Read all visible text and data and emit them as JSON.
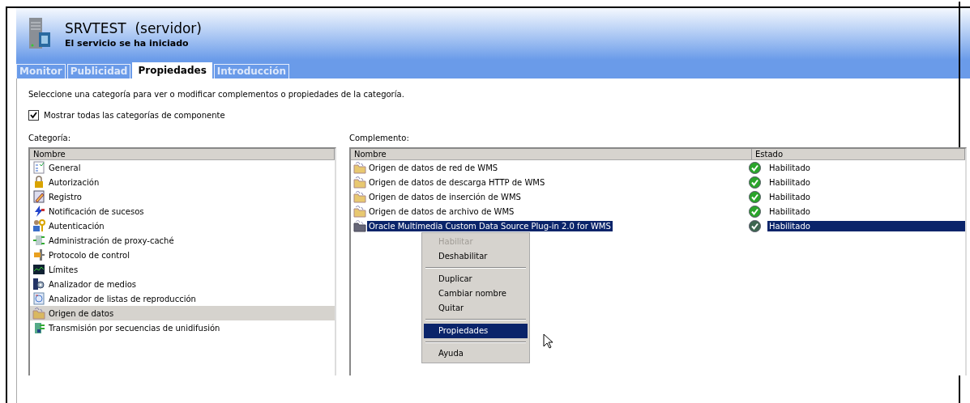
{
  "header": {
    "title": "SRVTEST  (servidor)",
    "subtitle": "El servicio se ha iniciado"
  },
  "tabs": [
    {
      "label": "Monitor",
      "selected": false
    },
    {
      "label": "Publicidad",
      "selected": false
    },
    {
      "label": "Propiedades",
      "selected": true
    },
    {
      "label": "Introducción",
      "selected": false
    }
  ],
  "instructions": "Seleccione una categoría para ver o modificar complementos o propiedades de la categoría.",
  "show_all_checkbox": {
    "label": "Mostrar todas las categorías de componente",
    "checked": true
  },
  "category_list": {
    "label": "Categoría:",
    "columns": [
      "Nombre"
    ],
    "items": [
      {
        "name": "General",
        "selected": false
      },
      {
        "name": "Autorización",
        "selected": false
      },
      {
        "name": "Registro",
        "selected": false
      },
      {
        "name": "Notificación de sucesos",
        "selected": false
      },
      {
        "name": "Autenticación",
        "selected": false
      },
      {
        "name": "Administración de proxy-caché",
        "selected": false
      },
      {
        "name": "Protocolo de control",
        "selected": false
      },
      {
        "name": "Límites",
        "selected": false
      },
      {
        "name": "Analizador de medios",
        "selected": false
      },
      {
        "name": "Analizador de listas de reproducción",
        "selected": false
      },
      {
        "name": "Origen de datos",
        "selected": true
      },
      {
        "name": "Transmisión por secuencias de unidifusión",
        "selected": false
      }
    ]
  },
  "plugin_list": {
    "label": "Complemento:",
    "columns": [
      "Nombre",
      "Estado"
    ],
    "rows": [
      {
        "name": "Origen de datos de red de WMS",
        "status": "Habilitado",
        "selected": false
      },
      {
        "name": "Origen de datos de descarga HTTP de WMS",
        "status": "Habilitado",
        "selected": false
      },
      {
        "name": "Origen de datos de inserción de WMS",
        "status": "Habilitado",
        "selected": false
      },
      {
        "name": "Origen de datos de archivo de WMS",
        "status": "Habilitado",
        "selected": false
      },
      {
        "name": "Oracle Multimedia Custom Data Source Plug-in 2.0 for WMS",
        "status": "Habilitado",
        "selected": true
      }
    ]
  },
  "context_menu": [
    {
      "kind": "item",
      "label": "Habilitar",
      "disabled": true,
      "selected": false
    },
    {
      "kind": "item",
      "label": "Deshabilitar",
      "disabled": false,
      "selected": false
    },
    {
      "kind": "separator"
    },
    {
      "kind": "item",
      "label": "Duplicar",
      "disabled": false,
      "selected": false
    },
    {
      "kind": "item",
      "label": "Cambiar nombre",
      "disabled": false,
      "selected": false
    },
    {
      "kind": "item",
      "label": "Quitar",
      "disabled": false,
      "selected": false
    },
    {
      "kind": "separator"
    },
    {
      "kind": "item",
      "label": "Propiedades",
      "disabled": false,
      "selected": true
    },
    {
      "kind": "separator"
    },
    {
      "kind": "item",
      "label": "Ayuda",
      "disabled": false,
      "selected": false
    }
  ]
}
